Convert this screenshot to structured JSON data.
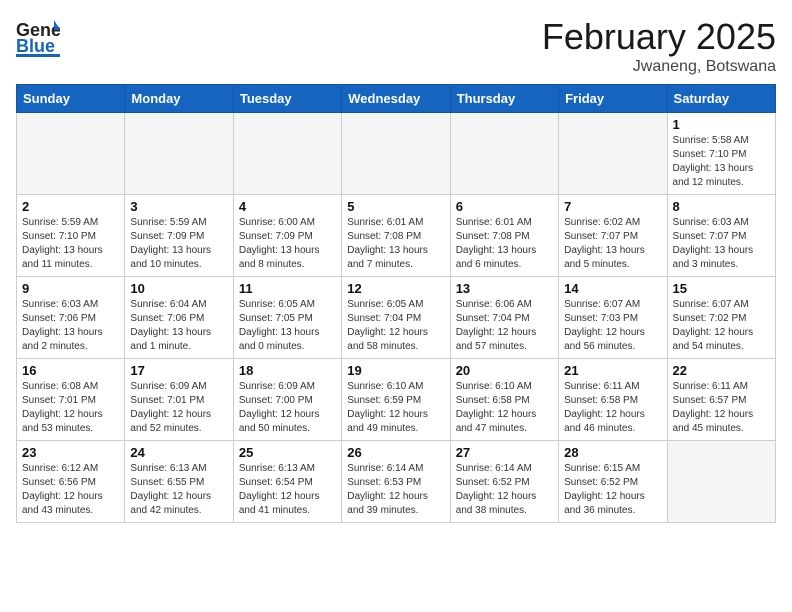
{
  "header": {
    "logo_general": "General",
    "logo_blue": "Blue",
    "title": "February 2025",
    "subtitle": "Jwaneng, Botswana"
  },
  "weekdays": [
    "Sunday",
    "Monday",
    "Tuesday",
    "Wednesday",
    "Thursday",
    "Friday",
    "Saturday"
  ],
  "weeks": [
    [
      {
        "day": "",
        "info": ""
      },
      {
        "day": "",
        "info": ""
      },
      {
        "day": "",
        "info": ""
      },
      {
        "day": "",
        "info": ""
      },
      {
        "day": "",
        "info": ""
      },
      {
        "day": "",
        "info": ""
      },
      {
        "day": "1",
        "info": "Sunrise: 5:58 AM\nSunset: 7:10 PM\nDaylight: 13 hours\nand 12 minutes."
      }
    ],
    [
      {
        "day": "2",
        "info": "Sunrise: 5:59 AM\nSunset: 7:10 PM\nDaylight: 13 hours\nand 11 minutes."
      },
      {
        "day": "3",
        "info": "Sunrise: 5:59 AM\nSunset: 7:09 PM\nDaylight: 13 hours\nand 10 minutes."
      },
      {
        "day": "4",
        "info": "Sunrise: 6:00 AM\nSunset: 7:09 PM\nDaylight: 13 hours\nand 8 minutes."
      },
      {
        "day": "5",
        "info": "Sunrise: 6:01 AM\nSunset: 7:08 PM\nDaylight: 13 hours\nand 7 minutes."
      },
      {
        "day": "6",
        "info": "Sunrise: 6:01 AM\nSunset: 7:08 PM\nDaylight: 13 hours\nand 6 minutes."
      },
      {
        "day": "7",
        "info": "Sunrise: 6:02 AM\nSunset: 7:07 PM\nDaylight: 13 hours\nand 5 minutes."
      },
      {
        "day": "8",
        "info": "Sunrise: 6:03 AM\nSunset: 7:07 PM\nDaylight: 13 hours\nand 3 minutes."
      }
    ],
    [
      {
        "day": "9",
        "info": "Sunrise: 6:03 AM\nSunset: 7:06 PM\nDaylight: 13 hours\nand 2 minutes."
      },
      {
        "day": "10",
        "info": "Sunrise: 6:04 AM\nSunset: 7:06 PM\nDaylight: 13 hours\nand 1 minute."
      },
      {
        "day": "11",
        "info": "Sunrise: 6:05 AM\nSunset: 7:05 PM\nDaylight: 13 hours\nand 0 minutes."
      },
      {
        "day": "12",
        "info": "Sunrise: 6:05 AM\nSunset: 7:04 PM\nDaylight: 12 hours\nand 58 minutes."
      },
      {
        "day": "13",
        "info": "Sunrise: 6:06 AM\nSunset: 7:04 PM\nDaylight: 12 hours\nand 57 minutes."
      },
      {
        "day": "14",
        "info": "Sunrise: 6:07 AM\nSunset: 7:03 PM\nDaylight: 12 hours\nand 56 minutes."
      },
      {
        "day": "15",
        "info": "Sunrise: 6:07 AM\nSunset: 7:02 PM\nDaylight: 12 hours\nand 54 minutes."
      }
    ],
    [
      {
        "day": "16",
        "info": "Sunrise: 6:08 AM\nSunset: 7:01 PM\nDaylight: 12 hours\nand 53 minutes."
      },
      {
        "day": "17",
        "info": "Sunrise: 6:09 AM\nSunset: 7:01 PM\nDaylight: 12 hours\nand 52 minutes."
      },
      {
        "day": "18",
        "info": "Sunrise: 6:09 AM\nSunset: 7:00 PM\nDaylight: 12 hours\nand 50 minutes."
      },
      {
        "day": "19",
        "info": "Sunrise: 6:10 AM\nSunset: 6:59 PM\nDaylight: 12 hours\nand 49 minutes."
      },
      {
        "day": "20",
        "info": "Sunrise: 6:10 AM\nSunset: 6:58 PM\nDaylight: 12 hours\nand 47 minutes."
      },
      {
        "day": "21",
        "info": "Sunrise: 6:11 AM\nSunset: 6:58 PM\nDaylight: 12 hours\nand 46 minutes."
      },
      {
        "day": "22",
        "info": "Sunrise: 6:11 AM\nSunset: 6:57 PM\nDaylight: 12 hours\nand 45 minutes."
      }
    ],
    [
      {
        "day": "23",
        "info": "Sunrise: 6:12 AM\nSunset: 6:56 PM\nDaylight: 12 hours\nand 43 minutes."
      },
      {
        "day": "24",
        "info": "Sunrise: 6:13 AM\nSunset: 6:55 PM\nDaylight: 12 hours\nand 42 minutes."
      },
      {
        "day": "25",
        "info": "Sunrise: 6:13 AM\nSunset: 6:54 PM\nDaylight: 12 hours\nand 41 minutes."
      },
      {
        "day": "26",
        "info": "Sunrise: 6:14 AM\nSunset: 6:53 PM\nDaylight: 12 hours\nand 39 minutes."
      },
      {
        "day": "27",
        "info": "Sunrise: 6:14 AM\nSunset: 6:52 PM\nDaylight: 12 hours\nand 38 minutes."
      },
      {
        "day": "28",
        "info": "Sunrise: 6:15 AM\nSunset: 6:52 PM\nDaylight: 12 hours\nand 36 minutes."
      },
      {
        "day": "",
        "info": ""
      }
    ]
  ]
}
